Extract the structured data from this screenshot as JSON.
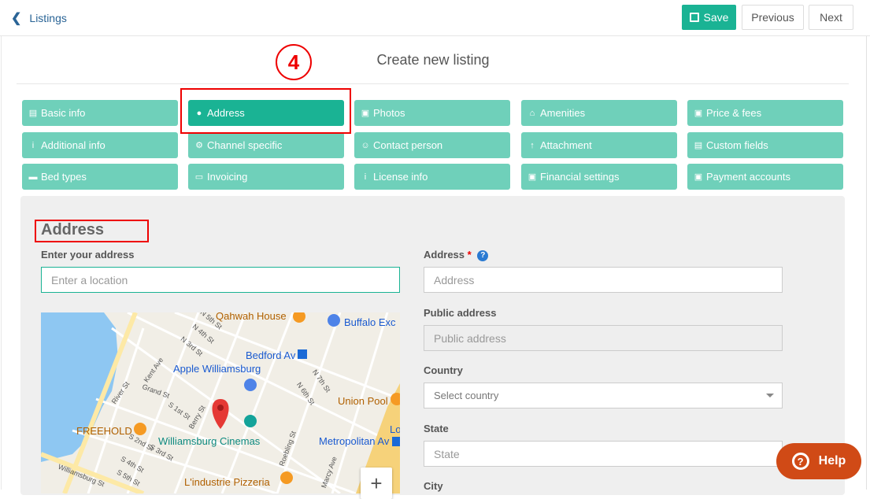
{
  "topbar": {
    "back_label": "Listings",
    "save_label": "Save",
    "previous_label": "Previous",
    "next_label": "Next"
  },
  "page": {
    "title": "Create new listing",
    "step_number": "4"
  },
  "tabs": [
    {
      "label": "Basic info",
      "icon": "id-card-icon"
    },
    {
      "label": "Address",
      "icon": "map-marker-icon"
    },
    {
      "label": "Photos",
      "icon": "camera-icon"
    },
    {
      "label": "Amenities",
      "icon": "home-icon"
    },
    {
      "label": "Price & fees",
      "icon": "money-icon"
    },
    {
      "label": "Additional info",
      "icon": "info-icon"
    },
    {
      "label": "Channel specific",
      "icon": "gear-icon"
    },
    {
      "label": "Contact person",
      "icon": "user-icon"
    },
    {
      "label": "Attachment",
      "icon": "upload-icon"
    },
    {
      "label": "Custom fields",
      "icon": "id-card-icon"
    },
    {
      "label": "Bed types",
      "icon": "bed-icon"
    },
    {
      "label": "Invoicing",
      "icon": "credit-card-icon"
    },
    {
      "label": "License info",
      "icon": "info-icon"
    },
    {
      "label": "Financial settings",
      "icon": "money-icon"
    },
    {
      "label": "Payment accounts",
      "icon": "money-icon"
    }
  ],
  "active_tab": "Address",
  "form": {
    "heading": "Address",
    "enter_address_label": "Enter your address",
    "enter_address_placeholder": "Enter a location",
    "address_label": "Address",
    "address_required": "*",
    "address_placeholder": "Address",
    "public_address_label": "Public address",
    "public_address_placeholder": "Public address",
    "country_label": "Country",
    "country_placeholder": "Select country",
    "state_label": "State",
    "state_placeholder": "State",
    "city_label": "City"
  },
  "map": {
    "places": {
      "qahwah": "Qahwah House",
      "buffalo": "Buffalo Exc",
      "bedford": "Bedford Av",
      "apple": "Apple Williamsburg",
      "union_pool": "Union Pool",
      "freehold": "FREEHOLD",
      "cinemas": "Williamsburg Cinemas",
      "metropolitan": "Metropolitan Av",
      "lindustrie": "L'industrie Pizzeria",
      "lo": "Lo"
    },
    "streets": [
      "N 5th St",
      "N 4th St",
      "N 3rd St",
      "Kent Ave",
      "Grand St",
      "River St",
      "S 1st St",
      "Berry St",
      "S 2nd St",
      "S 3rd St",
      "S 4th St",
      "S 5th St",
      "N 7th St",
      "N 6th St",
      "Roebling St",
      "Marcy Ave",
      "Williamsburg St"
    ],
    "zoom_in": "+",
    "station_badge": "M"
  },
  "help": {
    "label": "Help"
  },
  "colors": {
    "primary": "#1ab394",
    "tab": "#6fd0ba",
    "highlight": "#ee0000",
    "help": "#d04a16"
  }
}
